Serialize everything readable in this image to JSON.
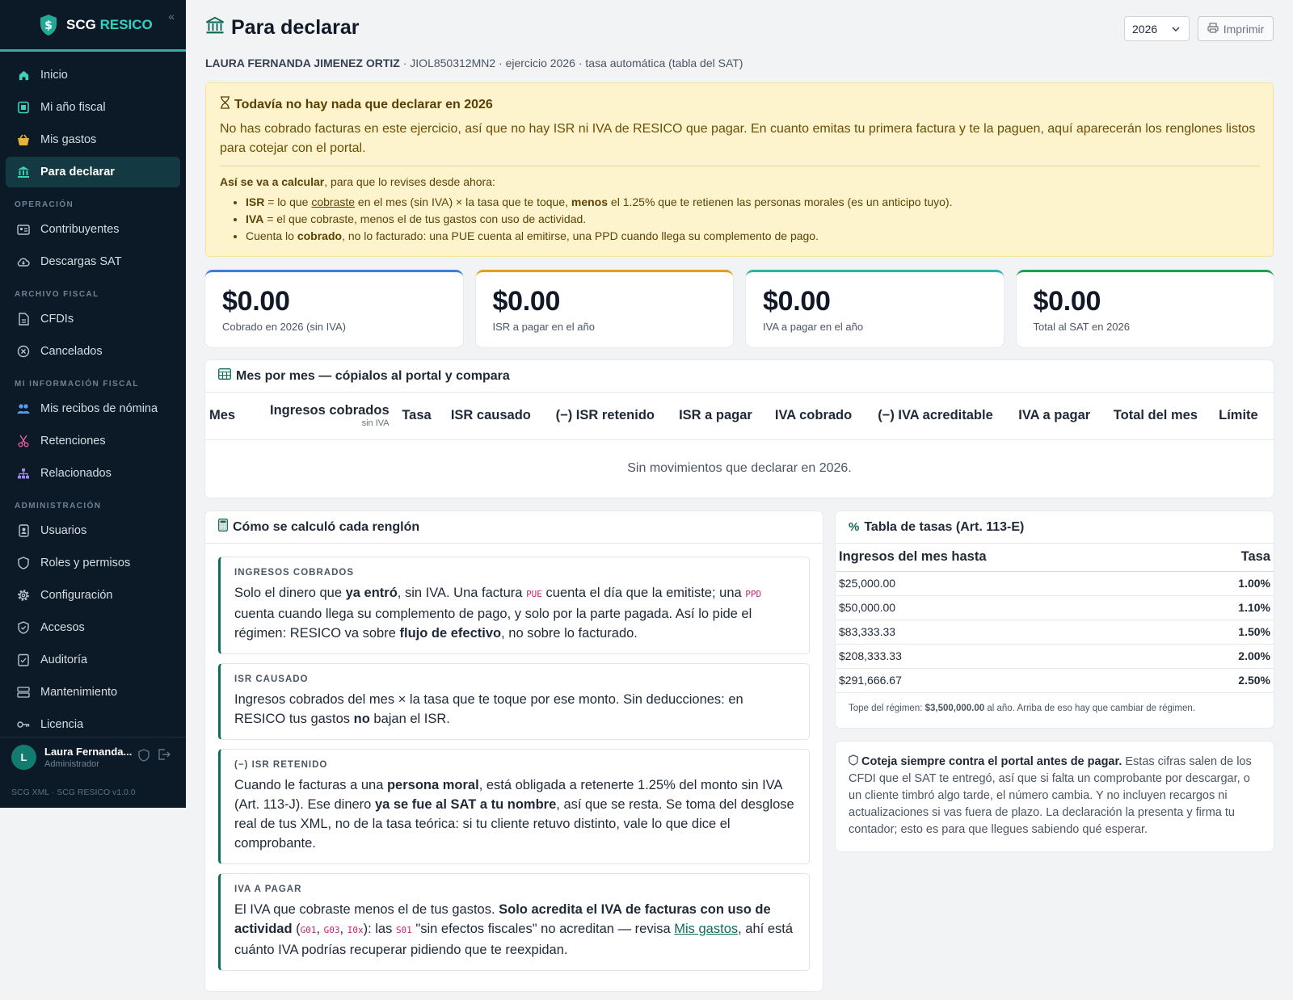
{
  "app": {
    "brand_a": "SCG",
    "brand_b": "RESICO"
  },
  "sidebar": {
    "items": [
      {
        "label": "Inicio",
        "icon": "home-icon"
      },
      {
        "label": "Mi año fiscal",
        "icon": "calendar-icon"
      },
      {
        "label": "Mis gastos",
        "icon": "basket-icon"
      },
      {
        "label": "Para declarar",
        "icon": "bank-icon",
        "active": true
      }
    ],
    "sections": [
      {
        "title": "OPERACIÓN",
        "items": [
          {
            "label": "Contribuyentes",
            "icon": "id-card-icon"
          },
          {
            "label": "Descargas SAT",
            "icon": "cloud-download-icon"
          }
        ]
      },
      {
        "title": "ARCHIVO FISCAL",
        "items": [
          {
            "label": "CFDIs",
            "icon": "file-icon"
          },
          {
            "label": "Cancelados",
            "icon": "circle-x-icon"
          }
        ]
      },
      {
        "title": "MI INFORMACIÓN FISCAL",
        "items": [
          {
            "label": "Mis recibos de nómina",
            "icon": "users-icon"
          },
          {
            "label": "Retenciones",
            "icon": "scissors-icon"
          },
          {
            "label": "Relacionados",
            "icon": "hierarchy-icon"
          }
        ]
      },
      {
        "title": "ADMINISTRACIÓN",
        "items": [
          {
            "label": "Usuarios",
            "icon": "user-badge-icon"
          },
          {
            "label": "Roles y permisos",
            "icon": "shield-icon"
          },
          {
            "label": "Configuración",
            "icon": "gear-icon"
          },
          {
            "label": "Accesos",
            "icon": "shield-check-icon"
          },
          {
            "label": "Auditoría",
            "icon": "checklist-icon"
          },
          {
            "label": "Mantenimiento",
            "icon": "server-icon"
          },
          {
            "label": "Licencia",
            "icon": "key-icon"
          }
        ]
      }
    ],
    "user": {
      "initial": "L",
      "name": "Laura Fernanda...",
      "role": "Administrador"
    },
    "version": "SCG XML · SCG RESICO v1.0.0"
  },
  "header": {
    "title": "Para declarar",
    "taxpayer": "LAURA FERNANDA JIMENEZ ORTIZ",
    "details": " · JIOL850312MN2 · ejercicio 2026 · tasa automática (tabla del SAT)",
    "year": "2026",
    "print_label": "Imprimir"
  },
  "notice": {
    "title": "Todavía no hay nada que declarar en 2026",
    "lead": "No has cobrado facturas en este ejercicio, así que no hay ISR ni IVA de RESICO que pagar. En cuanto emitas tu primera factura y te la paguen, aquí aparecerán los renglones listos para cotejar con el portal.",
    "howto_bold": "Así se va a calcular",
    "howto_rest": ", para que lo revises desde ahora:",
    "b1_a": "ISR",
    "b1_b": " = lo que ",
    "b1_c": "cobraste",
    "b1_d": " en el mes (sin IVA) × la tasa que te toque, ",
    "b1_e": "menos",
    "b1_f": " el 1.25% que te retienen las personas morales (es un anticipo tuyo).",
    "b2_a": "IVA",
    "b2_b": " = el que cobraste, menos el de tus gastos con uso de actividad.",
    "b3_a": "Cuenta lo ",
    "b3_b": "cobrado",
    "b3_c": ", no lo facturado: una PUE cuenta al emitirse, una PPD cuando llega su complemento de pago."
  },
  "cards": [
    {
      "amount": "$0.00",
      "label": "Cobrado en 2026 (sin IVA)",
      "color": "#3b7fd9"
    },
    {
      "amount": "$0.00",
      "label": "ISR a pagar en el año",
      "color": "#e0a01b"
    },
    {
      "amount": "$0.00",
      "label": "IVA a pagar en el año",
      "color": "#2bb3a8"
    },
    {
      "amount": "$0.00",
      "label": "Total al SAT en 2026",
      "color": "#1fa050"
    }
  ],
  "monthly": {
    "title": "Mes por mes — cópialos al portal y compara",
    "cols": [
      "Mes",
      "Ingresos cobrados",
      "Tasa",
      "ISR causado",
      "(−) ISR retenido",
      "ISR a pagar",
      "IVA cobrado",
      "(−) IVA acreditable",
      "IVA a pagar",
      "Total del mes",
      "Límite"
    ],
    "col_sub": "sin IVA",
    "empty": "Sin movimientos que declarar en 2026."
  },
  "calc": {
    "title": "Cómo se calculó cada renglón",
    "i1_k": "INGRESOS COBRADOS",
    "i1_a": "Solo el dinero que ",
    "i1_b": "ya entró",
    "i1_c": ", sin IVA. Una factura ",
    "i1_d": "PUE",
    "i1_e": " cuenta el día que la emitiste; una ",
    "i1_f": "PPD",
    "i1_g": " cuenta cuando llega su complemento de pago, y solo por la parte pagada. Así lo pide el régimen: RESICO va sobre ",
    "i1_h": "flujo de efectivo",
    "i1_i": ", no sobre lo facturado.",
    "i2_k": "ISR CAUSADO",
    "i2_a": "Ingresos cobrados del mes × la tasa que te toque por ese monto. Sin deducciones: en RESICO tus gastos ",
    "i2_b": "no",
    "i2_c": " bajan el ISR.",
    "i3_k": "(−) ISR RETENIDO",
    "i3_a": "Cuando le facturas a una ",
    "i3_b": "persona moral",
    "i3_c": ", está obligada a retenerte 1.25% del monto sin IVA (Art. 113-J). Ese dinero ",
    "i3_d": "ya se fue al SAT a tu nombre",
    "i3_e": ", así que se resta. Se toma del desglose real de tus XML, no de la tasa teórica: si tu cliente retuvo distinto, vale lo que dice el comprobante.",
    "i4_k": "IVA A PAGAR",
    "i4_a": "El IVA que cobraste menos el de tus gastos. ",
    "i4_b": "Solo acredita el IVA de facturas con uso de actividad",
    "i4_c": " (",
    "i4_d": "G01",
    "i4_e": ", ",
    "i4_f": "G03",
    "i4_g": ", ",
    "i4_h": "I0x",
    "i4_i": "): las ",
    "i4_j": "S01",
    "i4_k2": " \"sin efectos fiscales\" no acreditan — revisa ",
    "i4_l": "Mis gastos",
    "i4_m": ", ahí está cuánto IVA podrías recuperar pidiendo que te reexpidan."
  },
  "rates": {
    "title": "Tabla de tasas (Art. 113-E)",
    "col1": "Ingresos del mes hasta",
    "col2": "Tasa",
    "rows": [
      {
        "limit": "$25,000.00",
        "rate": "1.00%"
      },
      {
        "limit": "$50,000.00",
        "rate": "1.10%"
      },
      {
        "limit": "$83,333.33",
        "rate": "1.50%"
      },
      {
        "limit": "$208,333.33",
        "rate": "2.00%"
      },
      {
        "limit": "$291,666.67",
        "rate": "2.50%"
      }
    ],
    "note_a": "Tope del régimen: ",
    "note_b": "$3,500,000.00",
    "note_c": " al año. Arriba de eso hay que cambiar de régimen."
  },
  "verify": {
    "bold": "Coteja siempre contra el portal antes de pagar.",
    "rest": " Estas cifras salen de los CFDI que el SAT te entregó, así que si falta un comprobante por descargar, o un cliente timbró algo tarde, el número cambia. Y no incluyen recargos ni actualizaciones si vas fuera de plazo. La declaración la presenta y firma tu contador; esto es para que llegues sabiendo qué esperar."
  }
}
